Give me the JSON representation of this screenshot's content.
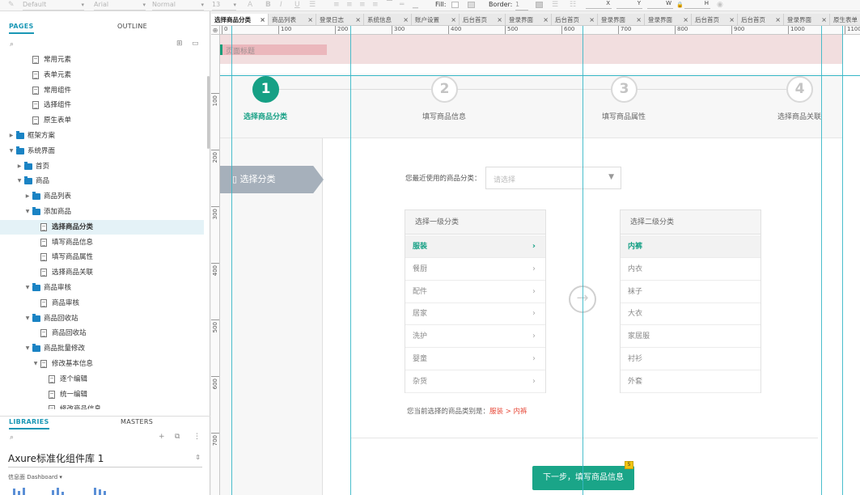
{
  "toolbar": {
    "style_select": "Default",
    "font_select": "Arial",
    "weight_select": "Normal",
    "size_select": "13",
    "fill_label": "Fill:",
    "border_label": "Border:",
    "border_value": "1",
    "x_label": "X",
    "y_label": "Y",
    "w_label": "W",
    "h_label": "H"
  },
  "pages_panel": {
    "tab_pages": "PAGES",
    "tab_outline": "OUTLINE",
    "tree": [
      {
        "label": "常用元素",
        "type": "page",
        "indent": 2
      },
      {
        "label": "表单元素",
        "type": "page",
        "indent": 2
      },
      {
        "label": "常用组件",
        "type": "page",
        "indent": 2
      },
      {
        "label": "选择组件",
        "type": "page",
        "indent": 2
      },
      {
        "label": "原生表单",
        "type": "page",
        "indent": 2
      },
      {
        "label": "框架方案",
        "type": "folder",
        "indent": 0,
        "expanded": false
      },
      {
        "label": "系统界面",
        "type": "folder",
        "indent": 0,
        "expanded": true
      },
      {
        "label": "首页",
        "type": "folder",
        "indent": 1,
        "expanded": false
      },
      {
        "label": "商品",
        "type": "folder",
        "indent": 1,
        "expanded": true
      },
      {
        "label": "商品列表",
        "type": "folder",
        "indent": 2,
        "expanded": false
      },
      {
        "label": "添加商品",
        "type": "folder",
        "indent": 2,
        "expanded": true
      },
      {
        "label": "选择商品分类",
        "type": "page",
        "indent": 3,
        "selected": true
      },
      {
        "label": "填写商品信息",
        "type": "page",
        "indent": 3
      },
      {
        "label": "填写商品属性",
        "type": "page",
        "indent": 3
      },
      {
        "label": "选择商品关联",
        "type": "page",
        "indent": 3
      },
      {
        "label": "商品审核",
        "type": "folder",
        "indent": 2,
        "expanded": true
      },
      {
        "label": "商品审核",
        "type": "page",
        "indent": 3
      },
      {
        "label": "商品回收站",
        "type": "folder",
        "indent": 2,
        "expanded": true
      },
      {
        "label": "商品回收站",
        "type": "page",
        "indent": 3
      },
      {
        "label": "商品批量修改",
        "type": "folder",
        "indent": 2,
        "expanded": true
      },
      {
        "label": "修改基本信息",
        "type": "page",
        "indent": 3,
        "expanded": true
      },
      {
        "label": "逐个编辑",
        "type": "page",
        "indent": 4
      },
      {
        "label": "统一编辑",
        "type": "page",
        "indent": 4
      },
      {
        "label": "修改商品信息",
        "type": "page",
        "indent": 4
      }
    ]
  },
  "libraries_panel": {
    "tab_libraries": "LIBRARIES",
    "tab_masters": "MASTERS",
    "library_name": "Axure标准化组件库 1",
    "sub_label": "信息面 Dashboard ▾"
  },
  "doc_tabs": [
    {
      "label": "选择商品分类",
      "active": true
    },
    {
      "label": "商品列表"
    },
    {
      "label": "登录日志"
    },
    {
      "label": "系统信息"
    },
    {
      "label": "账户设置"
    },
    {
      "label": "后台首页"
    },
    {
      "label": "登录界面"
    },
    {
      "label": "后台首页"
    },
    {
      "label": "登录界面"
    },
    {
      "label": "登录界面"
    },
    {
      "label": "后台首页"
    },
    {
      "label": "后台首页"
    },
    {
      "label": "登录界面"
    },
    {
      "label": "原生表单"
    }
  ],
  "ruler": {
    "h_ticks": [
      "0",
      "100",
      "200",
      "300",
      "400",
      "500",
      "600",
      "700",
      "800",
      "900",
      "1000",
      "1100"
    ],
    "v_ticks": [
      "100",
      "200",
      "300",
      "400",
      "500",
      "600",
      "700"
    ]
  },
  "canvas": {
    "page_title": "页面标题",
    "steps": [
      {
        "num": "1",
        "label": "选择商品分类",
        "active": true
      },
      {
        "num": "2",
        "label": "填写商品信息",
        "active": false
      },
      {
        "num": "3",
        "label": "填写商品属性",
        "active": false
      },
      {
        "num": "4",
        "label": "选择商品关联",
        "active": false
      }
    ],
    "side_nav_label": "选择分类",
    "recent_label": "您最近使用的商品分类：",
    "recent_placeholder": "请选择",
    "primary": {
      "header": "选择一级分类",
      "items": [
        "服装",
        "餐厨",
        "配件",
        "居家",
        "洗护",
        "婴童",
        "杂货"
      ],
      "selected_index": 0
    },
    "secondary": {
      "header": "选择二级分类",
      "items": [
        "内裤",
        "内衣",
        "袜子",
        "大衣",
        "家居服",
        "衬衫",
        "外套"
      ],
      "selected_index": 0
    },
    "current_label": "您当前选择的商品类别是：",
    "current_value": "服装 > 内裤",
    "next_button": "下一步，填写商品信息",
    "badge": "5"
  },
  "colors": {
    "accent": "#16a085",
    "guide": "#36b7c7",
    "title_bg": "#f2dedf",
    "warning": "#e74c3c"
  }
}
